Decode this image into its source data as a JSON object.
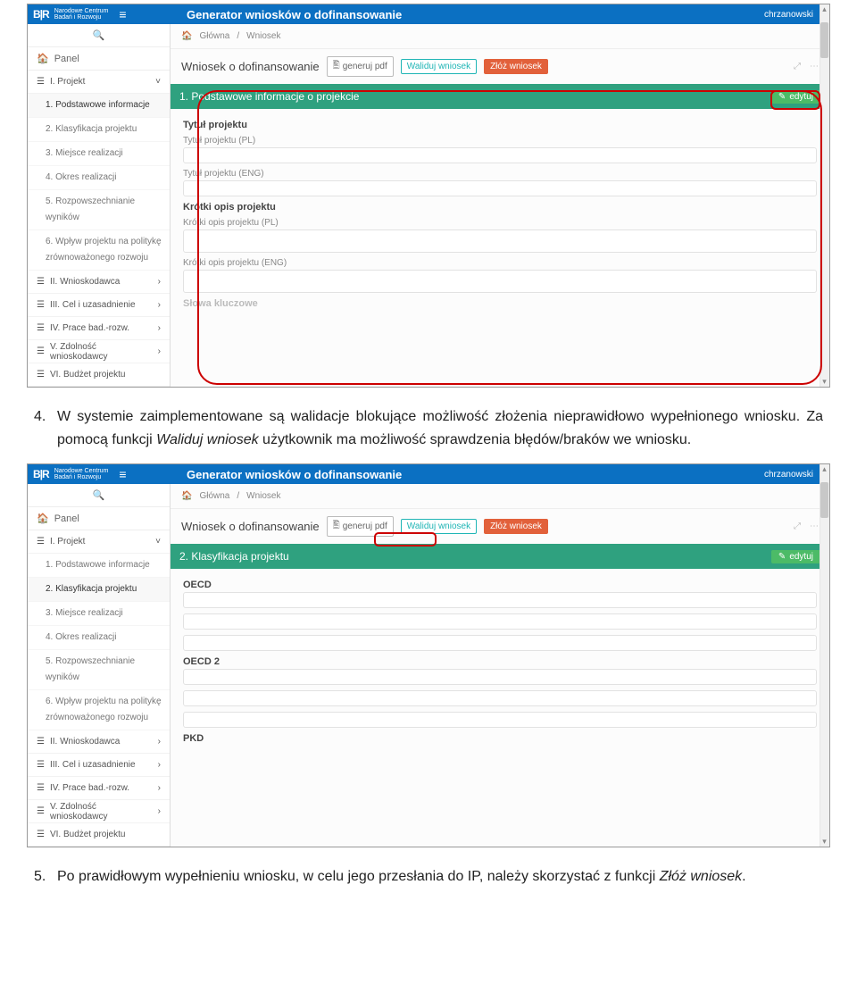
{
  "app": {
    "logo_main": "B|R",
    "logo_sub1": "Narodowe Centrum",
    "logo_sub2": "Badań i Rozwoju",
    "title": "Generator wniosków o dofinansowanie",
    "user": "chrzanowski"
  },
  "sidebar": {
    "panel": "Panel",
    "items": [
      {
        "label": "I. Projekt",
        "expand": "˅"
      },
      {
        "label": "II. Wnioskodawca",
        "expand": "›"
      },
      {
        "label": "III. Cel i uzasadnienie",
        "expand": "›"
      },
      {
        "label": "IV. Prace bad.-rozw.",
        "expand": "›"
      },
      {
        "label": "V. Zdolność wnioskodawcy",
        "expand": "›"
      },
      {
        "label": "VI. Budżet projektu",
        "expand": ""
      }
    ],
    "subs": [
      "1. Podstawowe informacje",
      "2. Klasyfikacja projektu",
      "3. Miejsce realizacji",
      "4. Okres realizacji",
      "5. Rozpowszechnianie wyników",
      "6. Wpływ projektu na politykę zrównoważonego rozwoju"
    ]
  },
  "crumbs": {
    "home": "Główna",
    "sep": "/",
    "wn": "Wniosek"
  },
  "headline": {
    "title": "Wniosek o dofinansowanie",
    "pdf": "generuj pdf",
    "val": "Waliduj wniosek",
    "submit": "Złóż wniosek"
  },
  "section1": {
    "head": "1. Podstawowe informacje o projekcie",
    "edit": "edytuj",
    "g1": "Tytuł projektu",
    "g1a": "Tytuł projektu (PL)",
    "g1b": "Tytuł projektu (ENG)",
    "g2": "Krótki opis projektu",
    "g2a": "Krótki opis projektu (PL)",
    "g2b": "Krótki opis projektu (ENG)",
    "g3cut": "Słowa kluczowe"
  },
  "section2": {
    "head": "2. Klasyfikacja projektu",
    "edit": "edytuj",
    "g1": "OECD",
    "g2": "OECD 2",
    "g3": "PKD"
  },
  "doc": {
    "p4_idx": "4.",
    "p4_a": "W systemie zaimplementowane są walidacje blokujące możliwość złożenia nieprawidłowo wypełnionego wniosku. Za pomocą funkcji ",
    "p4_i": "Waliduj wniosek",
    "p4_b": " użytkownik ma możliwość sprawdzenia błędów/braków we wniosku.",
    "p5_idx": "5.",
    "p5_a": "Po prawidłowym wypełnieniu wniosku, w celu jego przesłania do IP, należy skorzystać z funkcji ",
    "p5_i": "Złóż wniosek",
    "p5_b": "."
  }
}
